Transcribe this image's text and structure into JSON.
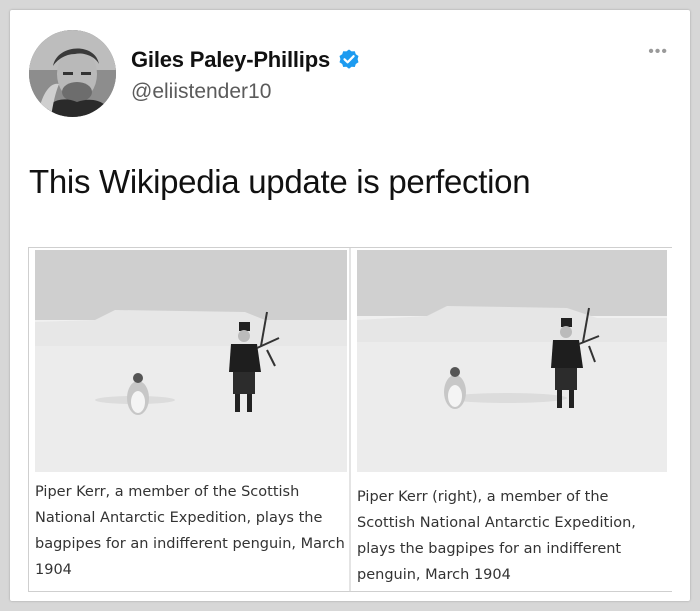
{
  "tweet": {
    "author_name": "Giles Paley-Phillips",
    "handle": "@eliistender10",
    "more_label": "•••",
    "text": "This Wikipedia update is perfection"
  },
  "media": {
    "left_caption": "Piper Kerr, a member of the Scottish National Antarctic Expedition, plays the bagpipes for an indifferent penguin, March 1904",
    "right_caption": "Piper Kerr (right), a member of the Scottish National Antarctic Expedition, plays the bagpipes for an indifferent penguin, March 1904"
  },
  "colors": {
    "verified_badge": "#1d9bf0",
    "name_text": "#111111",
    "handle_text": "#5b5b5b"
  },
  "icons": {
    "verified": "verified-badge-icon",
    "more": "more-options-icon"
  }
}
